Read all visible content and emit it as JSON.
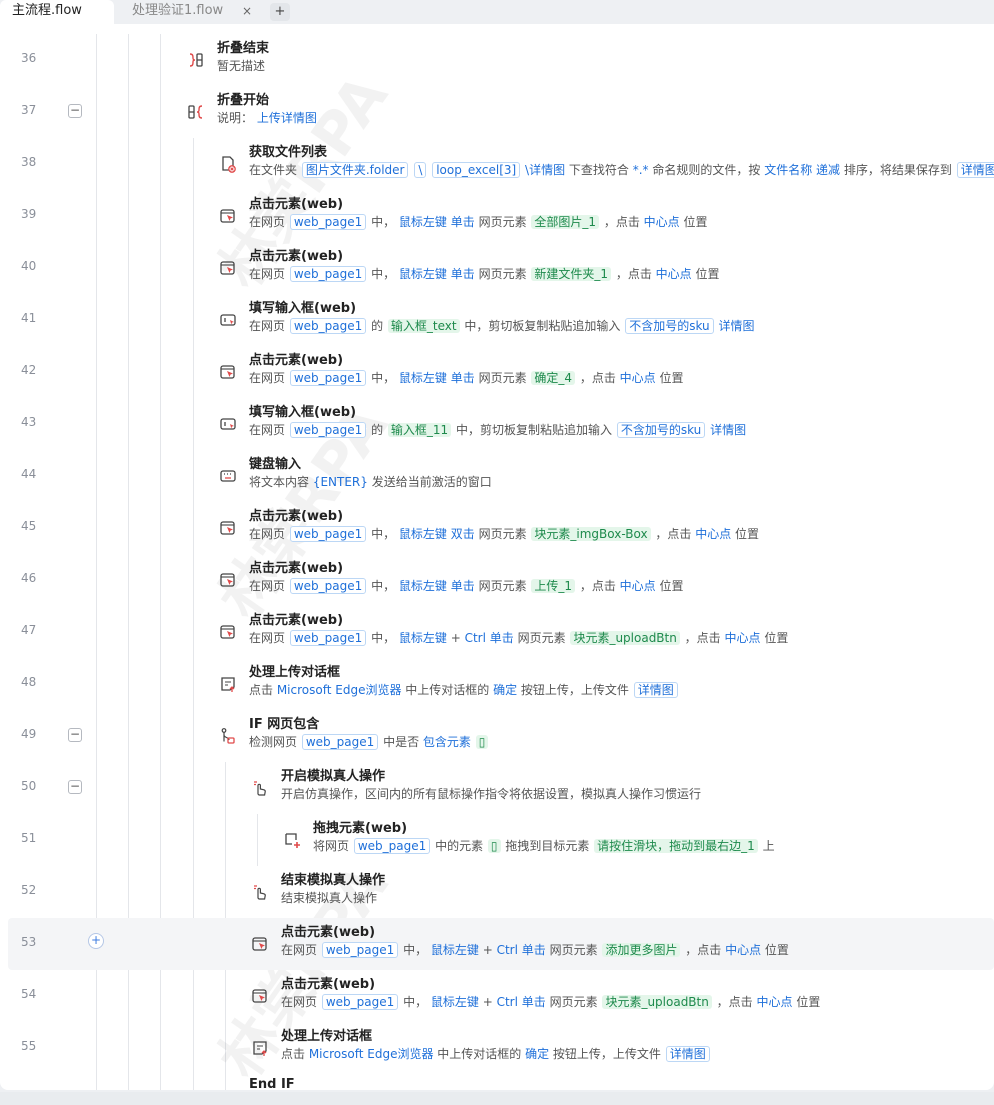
{
  "tabs": [
    {
      "label": "主流程.flow",
      "active": true
    },
    {
      "label": "处理验证1.flow",
      "active": false,
      "close": "×"
    }
  ],
  "tab_add": "+",
  "add_step": "+",
  "watermark": [
    "林棠RPA",
    "林棠RPA",
    "林棠RPA"
  ],
  "colors": {
    "keyword": "#1e6fd9",
    "element": "#1e8a4c",
    "element_bg": "#e4f6ea"
  },
  "rows": [
    {
      "line": "36",
      "indent": 0,
      "icon": "fold-end-icon",
      "title": "折叠结束",
      "desc": [
        {
          "k": "t",
          "v": "暂无描述"
        }
      ]
    },
    {
      "line": "37",
      "indent": 0,
      "collapse": "−",
      "icon": "fold-start-icon",
      "title": "折叠开始",
      "desc": [
        {
          "k": "t",
          "v": "说明： "
        },
        {
          "k": "kw",
          "v": "上传详情图"
        }
      ]
    },
    {
      "line": "38",
      "indent": 1,
      "icon": "file-list-icon",
      "title": "获取文件列表",
      "desc": [
        {
          "k": "t",
          "v": "在文件夹 "
        },
        {
          "k": "var",
          "v": "图片文件夹.folder"
        },
        {
          "k": "t",
          "v": " "
        },
        {
          "k": "var",
          "v": "\\"
        },
        {
          "k": "t",
          "v": " "
        },
        {
          "k": "var",
          "v": "loop_excel[3]"
        },
        {
          "k": "t",
          "v": " "
        },
        {
          "k": "kw",
          "v": "\\详情图"
        },
        {
          "k": "t",
          "v": " 下查找符合 "
        },
        {
          "k": "kw",
          "v": "*.*"
        },
        {
          "k": "t",
          "v": " 命名规则的文件，按 "
        },
        {
          "k": "kw",
          "v": "文件名称"
        },
        {
          "k": "t",
          "v": " "
        },
        {
          "k": "kw",
          "v": "递减"
        },
        {
          "k": "t",
          "v": " 排序，将结果保存到 "
        },
        {
          "k": "var",
          "v": "详情图"
        }
      ]
    },
    {
      "line": "39",
      "indent": 1,
      "icon": "click-element-icon",
      "title": "点击元素(web)",
      "desc": [
        {
          "k": "t",
          "v": "在网页 "
        },
        {
          "k": "var",
          "v": "web_page1"
        },
        {
          "k": "t",
          "v": " 中， "
        },
        {
          "k": "kw",
          "v": "鼠标左键"
        },
        {
          "k": "t",
          "v": " "
        },
        {
          "k": "kw",
          "v": "单击"
        },
        {
          "k": "t",
          "v": " 网页元素 "
        },
        {
          "k": "el",
          "v": "全部图片_1"
        },
        {
          "k": "t",
          "v": " ，点击 "
        },
        {
          "k": "kw",
          "v": "中心点"
        },
        {
          "k": "t",
          "v": " 位置"
        }
      ]
    },
    {
      "line": "40",
      "indent": 1,
      "icon": "click-element-icon",
      "title": "点击元素(web)",
      "desc": [
        {
          "k": "t",
          "v": "在网页 "
        },
        {
          "k": "var",
          "v": "web_page1"
        },
        {
          "k": "t",
          "v": " 中， "
        },
        {
          "k": "kw",
          "v": "鼠标左键"
        },
        {
          "k": "t",
          "v": " "
        },
        {
          "k": "kw",
          "v": "单击"
        },
        {
          "k": "t",
          "v": " 网页元素 "
        },
        {
          "k": "el",
          "v": "新建文件夹_1"
        },
        {
          "k": "t",
          "v": " ，点击 "
        },
        {
          "k": "kw",
          "v": "中心点"
        },
        {
          "k": "t",
          "v": " 位置"
        }
      ]
    },
    {
      "line": "41",
      "indent": 1,
      "icon": "input-box-icon",
      "title": "填写输入框(web)",
      "desc": [
        {
          "k": "t",
          "v": "在网页 "
        },
        {
          "k": "var",
          "v": "web_page1"
        },
        {
          "k": "t",
          "v": " 的 "
        },
        {
          "k": "el",
          "v": "输入框_text"
        },
        {
          "k": "t",
          "v": " 中，剪切板复制粘贴追加输入 "
        },
        {
          "k": "var",
          "v": "不含加号的sku"
        },
        {
          "k": "t",
          "v": " "
        },
        {
          "k": "kw",
          "v": "详情图"
        }
      ]
    },
    {
      "line": "42",
      "indent": 1,
      "icon": "click-element-icon",
      "title": "点击元素(web)",
      "desc": [
        {
          "k": "t",
          "v": "在网页 "
        },
        {
          "k": "var",
          "v": "web_page1"
        },
        {
          "k": "t",
          "v": " 中， "
        },
        {
          "k": "kw",
          "v": "鼠标左键"
        },
        {
          "k": "t",
          "v": " "
        },
        {
          "k": "kw",
          "v": "单击"
        },
        {
          "k": "t",
          "v": " 网页元素 "
        },
        {
          "k": "el",
          "v": "确定_4"
        },
        {
          "k": "t",
          "v": " ，点击 "
        },
        {
          "k": "kw",
          "v": "中心点"
        },
        {
          "k": "t",
          "v": " 位置"
        }
      ]
    },
    {
      "line": "43",
      "indent": 1,
      "icon": "input-box-icon",
      "title": "填写输入框(web)",
      "desc": [
        {
          "k": "t",
          "v": "在网页 "
        },
        {
          "k": "var",
          "v": "web_page1"
        },
        {
          "k": "t",
          "v": " 的 "
        },
        {
          "k": "el",
          "v": "输入框_11"
        },
        {
          "k": "t",
          "v": " 中，剪切板复制粘贴追加输入 "
        },
        {
          "k": "var",
          "v": "不含加号的sku"
        },
        {
          "k": "t",
          "v": " "
        },
        {
          "k": "kw",
          "v": "详情图"
        }
      ]
    },
    {
      "line": "44",
      "indent": 1,
      "icon": "keyboard-icon",
      "title": "键盘输入",
      "desc": [
        {
          "k": "t",
          "v": "将文本内容 "
        },
        {
          "k": "kw",
          "v": "{ENTER}"
        },
        {
          "k": "t",
          "v": " 发送给当前激活的窗口"
        }
      ]
    },
    {
      "line": "45",
      "indent": 1,
      "icon": "click-element-icon",
      "title": "点击元素(web)",
      "desc": [
        {
          "k": "t",
          "v": "在网页 "
        },
        {
          "k": "var",
          "v": "web_page1"
        },
        {
          "k": "t",
          "v": " 中， "
        },
        {
          "k": "kw",
          "v": "鼠标左键"
        },
        {
          "k": "t",
          "v": " "
        },
        {
          "k": "kw",
          "v": "双击"
        },
        {
          "k": "t",
          "v": " 网页元素 "
        },
        {
          "k": "el",
          "v": "块元素_imgBox-Box"
        },
        {
          "k": "t",
          "v": " ，点击 "
        },
        {
          "k": "kw",
          "v": "中心点"
        },
        {
          "k": "t",
          "v": " 位置"
        }
      ]
    },
    {
      "line": "46",
      "indent": 1,
      "icon": "click-element-icon",
      "title": "点击元素(web)",
      "desc": [
        {
          "k": "t",
          "v": "在网页 "
        },
        {
          "k": "var",
          "v": "web_page1"
        },
        {
          "k": "t",
          "v": " 中， "
        },
        {
          "k": "kw",
          "v": "鼠标左键"
        },
        {
          "k": "t",
          "v": " "
        },
        {
          "k": "kw",
          "v": "单击"
        },
        {
          "k": "t",
          "v": " 网页元素 "
        },
        {
          "k": "el",
          "v": "上传_1"
        },
        {
          "k": "t",
          "v": " ，点击 "
        },
        {
          "k": "kw",
          "v": "中心点"
        },
        {
          "k": "t",
          "v": " 位置"
        }
      ]
    },
    {
      "line": "47",
      "indent": 1,
      "icon": "click-element-icon",
      "title": "点击元素(web)",
      "desc": [
        {
          "k": "t",
          "v": "在网页 "
        },
        {
          "k": "var",
          "v": "web_page1"
        },
        {
          "k": "t",
          "v": " 中， "
        },
        {
          "k": "kw",
          "v": "鼠标左键"
        },
        {
          "k": "t",
          "v": " + "
        },
        {
          "k": "kw",
          "v": "Ctrl"
        },
        {
          "k": "t",
          "v": " "
        },
        {
          "k": "kw",
          "v": "单击"
        },
        {
          "k": "t",
          "v": " 网页元素 "
        },
        {
          "k": "el",
          "v": "块元素_uploadBtn"
        },
        {
          "k": "t",
          "v": " ，点击 "
        },
        {
          "k": "kw",
          "v": "中心点"
        },
        {
          "k": "t",
          "v": " 位置"
        }
      ]
    },
    {
      "line": "48",
      "indent": 1,
      "icon": "upload-dialog-icon",
      "title": "处理上传对话框",
      "desc": [
        {
          "k": "t",
          "v": "点击 "
        },
        {
          "k": "kw",
          "v": "Microsoft Edge浏览器"
        },
        {
          "k": "t",
          "v": " 中上传对话框的 "
        },
        {
          "k": "kw",
          "v": "确定"
        },
        {
          "k": "t",
          "v": " 按钮上传，上传文件 "
        },
        {
          "k": "var",
          "v": "详情图"
        }
      ]
    },
    {
      "line": "49",
      "indent": 1,
      "collapse": "−",
      "icon": "if-branch-icon",
      "title": "IF 网页包含",
      "desc": [
        {
          "k": "t",
          "v": "检测网页 "
        },
        {
          "k": "var",
          "v": "web_page1"
        },
        {
          "k": "t",
          "v": " 中是否 "
        },
        {
          "k": "kw",
          "v": "包含元素"
        },
        {
          "k": "t",
          "v": " "
        },
        {
          "k": "el",
          "v": "▯"
        }
      ]
    },
    {
      "line": "50",
      "indent": 2,
      "collapse": "−",
      "icon": "hand-pointer-icon",
      "title": "开启模拟真人操作",
      "desc": [
        {
          "k": "t",
          "v": "开启仿真操作，区间内的所有鼠标操作指令将依据设置，模拟真人操作习惯运行"
        }
      ]
    },
    {
      "line": "51",
      "indent": 3,
      "icon": "drag-element-icon",
      "title": "拖拽元素(web)",
      "desc": [
        {
          "k": "t",
          "v": "将网页 "
        },
        {
          "k": "var",
          "v": "web_page1"
        },
        {
          "k": "t",
          "v": " 中的元素 "
        },
        {
          "k": "el",
          "v": "▯"
        },
        {
          "k": "t",
          "v": " 拖拽到目标元素 "
        },
        {
          "k": "el",
          "v": "请按住滑块，拖动到最右边_1"
        },
        {
          "k": "t",
          "v": " 上"
        }
      ]
    },
    {
      "line": "52",
      "indent": 2,
      "icon": "hand-pointer-icon",
      "title": "结束模拟真人操作",
      "desc": [
        {
          "k": "t",
          "v": "结束模拟真人操作"
        }
      ]
    },
    {
      "line": "53",
      "indent": 2,
      "highlight": true,
      "icon": "click-element-icon",
      "title": "点击元素(web)",
      "desc": [
        {
          "k": "t",
          "v": "在网页 "
        },
        {
          "k": "var",
          "v": "web_page1"
        },
        {
          "k": "t",
          "v": " 中， "
        },
        {
          "k": "kw",
          "v": "鼠标左键"
        },
        {
          "k": "t",
          "v": " + "
        },
        {
          "k": "kw",
          "v": "Ctrl"
        },
        {
          "k": "t",
          "v": " "
        },
        {
          "k": "kw",
          "v": "单击"
        },
        {
          "k": "t",
          "v": " 网页元素 "
        },
        {
          "k": "el",
          "v": "添加更多图片"
        },
        {
          "k": "t",
          "v": " ，点击 "
        },
        {
          "k": "kw",
          "v": "中心点"
        },
        {
          "k": "t",
          "v": " 位置"
        }
      ]
    },
    {
      "line": "54",
      "indent": 2,
      "icon": "click-element-icon",
      "title": "点击元素(web)",
      "desc": [
        {
          "k": "t",
          "v": "在网页 "
        },
        {
          "k": "var",
          "v": "web_page1"
        },
        {
          "k": "t",
          "v": " 中， "
        },
        {
          "k": "kw",
          "v": "鼠标左键"
        },
        {
          "k": "t",
          "v": " + "
        },
        {
          "k": "kw",
          "v": "Ctrl"
        },
        {
          "k": "t",
          "v": " "
        },
        {
          "k": "kw",
          "v": "单击"
        },
        {
          "k": "t",
          "v": " 网页元素 "
        },
        {
          "k": "el",
          "v": "块元素_uploadBtn"
        },
        {
          "k": "t",
          "v": " ，点击 "
        },
        {
          "k": "kw",
          "v": "中心点"
        },
        {
          "k": "t",
          "v": " 位置"
        }
      ]
    },
    {
      "line": "55",
      "indent": 2,
      "icon": "upload-dialog-icon",
      "title": "处理上传对话框",
      "desc": [
        {
          "k": "t",
          "v": "点击 "
        },
        {
          "k": "kw",
          "v": "Microsoft Edge浏览器"
        },
        {
          "k": "t",
          "v": " 中上传对话框的 "
        },
        {
          "k": "kw",
          "v": "确定"
        },
        {
          "k": "t",
          "v": " 按钮上传，上传文件 "
        },
        {
          "k": "var",
          "v": "详情图"
        }
      ]
    },
    {
      "line": "",
      "indent": 1,
      "icon": "",
      "title": "End IF",
      "desc": []
    }
  ]
}
